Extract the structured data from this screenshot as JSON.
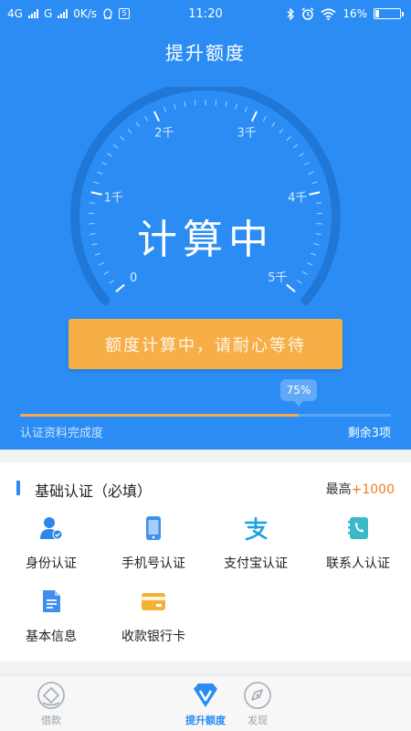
{
  "status_bar": {
    "network1": "4G",
    "network2": "G",
    "speed": "0K/s",
    "notif_box": "5",
    "time": "11:20",
    "battery": "16%",
    "battery_level": 0.16
  },
  "header": {
    "title": "提升额度"
  },
  "gauge": {
    "status_text": "计算中",
    "ticks": [
      "0",
      "1千",
      "2千",
      "3千",
      "4千",
      "5千"
    ]
  },
  "calc_button": {
    "label": "额度计算中，请耐心等待"
  },
  "progress": {
    "percent_label": "75%",
    "value": 0.75,
    "label": "认证资料完成度",
    "remaining": "剩余3项"
  },
  "basic_auth": {
    "title": "基础认证（必填）",
    "max_prefix": "最高",
    "max_bonus": "+1000",
    "items": [
      {
        "label": "身份认证",
        "icon": "id-card-user-icon",
        "color": "#2f86e6"
      },
      {
        "label": "手机号认证",
        "icon": "mobile-phone-icon",
        "color": "#3d8ff0"
      },
      {
        "label": "支付宝认证",
        "icon": "alipay-icon",
        "color": "#1aa1e4"
      },
      {
        "label": "联系人认证",
        "icon": "contacts-book-icon",
        "color": "#3ab9c9"
      },
      {
        "label": "基本信息",
        "icon": "document-icon",
        "color": "#3f8ff0"
      },
      {
        "label": "收款银行卡",
        "icon": "bank-card-icon",
        "color": "#f2b233"
      }
    ]
  },
  "tabbar": {
    "tabs": [
      {
        "label": "借款",
        "icon": "loan-icon",
        "active": false
      },
      {
        "label": "提升额度",
        "icon": "raise-limit-icon",
        "active": true
      },
      {
        "label": "发现",
        "icon": "compass-icon",
        "active": false
      }
    ]
  }
}
